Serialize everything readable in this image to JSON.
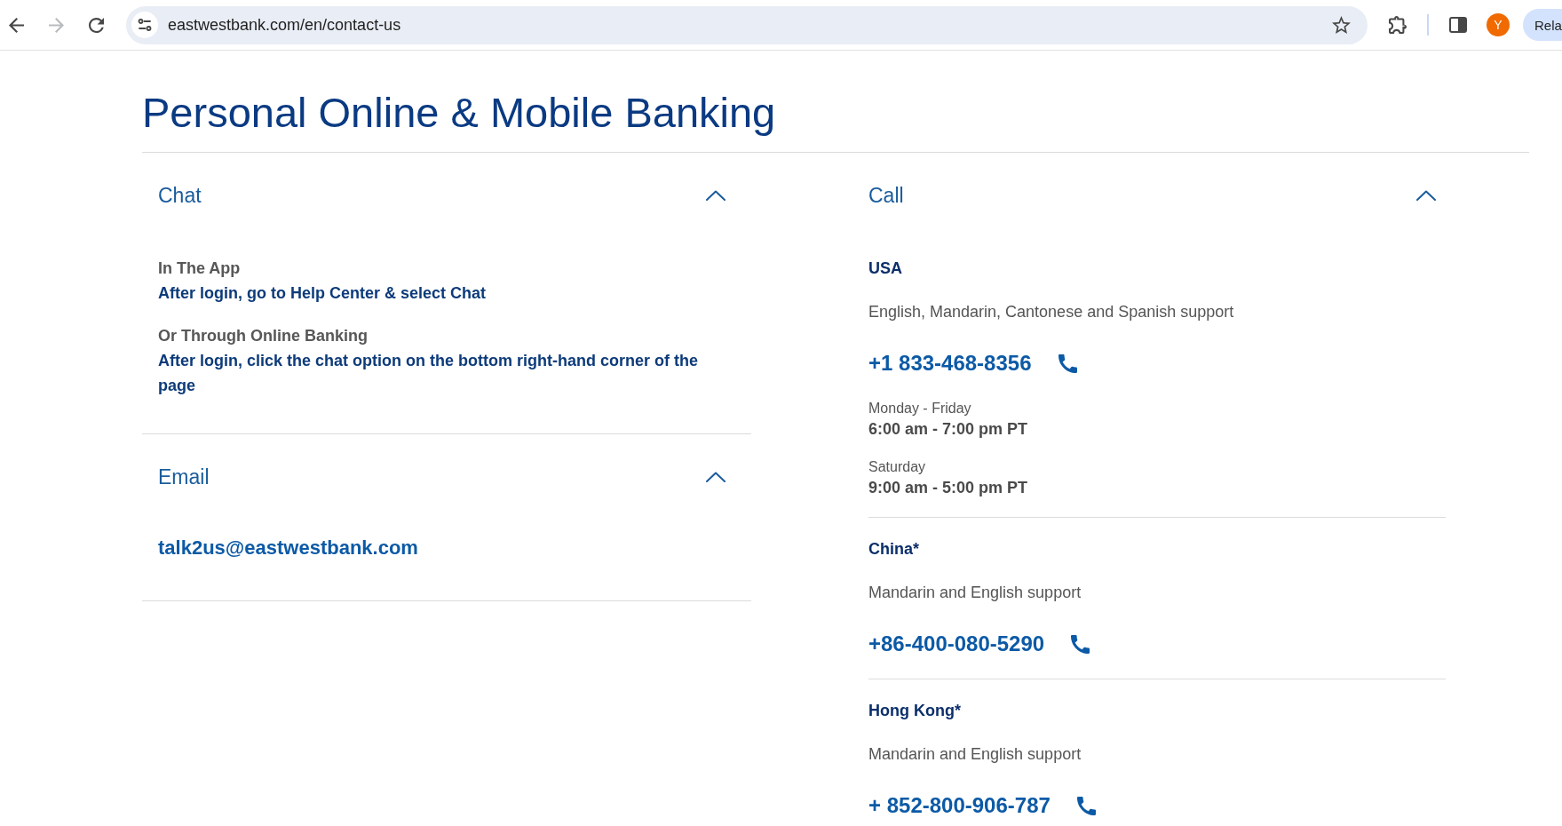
{
  "browser": {
    "nav_buttons": [
      {
        "kind": "back",
        "disabled": false
      },
      {
        "kind": "forward",
        "disabled": true
      },
      {
        "kind": "reload",
        "disabled": false
      }
    ],
    "url": "eastwestbank.com/en/contact-us",
    "profile_initial": "Y",
    "side_button": "Rela"
  },
  "page": {
    "title": "Personal Online & Mobile Banking",
    "columns": [
      {
        "sections": [
          {
            "kind": "steps",
            "heading": "Chat",
            "expanded": true,
            "steps": [
              {
                "label": "In The App",
                "text": "After login, go to Help Center & select Chat"
              },
              {
                "label": "Or Through Online Banking",
                "text": "After login, click the chat option on the bottom right-hand corner of the page"
              }
            ]
          },
          {
            "kind": "email",
            "heading": "Email",
            "expanded": true,
            "email": "talk2us@eastwestbank.com"
          }
        ]
      },
      {
        "sections": [
          {
            "kind": "regions",
            "heading": "Call",
            "expanded": true,
            "regions": [
              {
                "name": "USA",
                "support": "English, Mandarin, Cantonese and Spanish support",
                "phone": "+1 833-468-8356",
                "hours": [
                  {
                    "days": "Monday - Friday",
                    "time": "6:00 am - 7:00 pm PT"
                  },
                  {
                    "days": "Saturday",
                    "time": "9:00 am - 5:00 pm PT"
                  }
                ]
              },
              {
                "name": "China*",
                "support": "Mandarin and English support",
                "phone": "+86-400-080-5290"
              },
              {
                "name": "Hong Kong*",
                "support": "Mandarin and English support",
                "phone": "+ 852-800-906-787"
              }
            ]
          }
        ]
      }
    ]
  }
}
